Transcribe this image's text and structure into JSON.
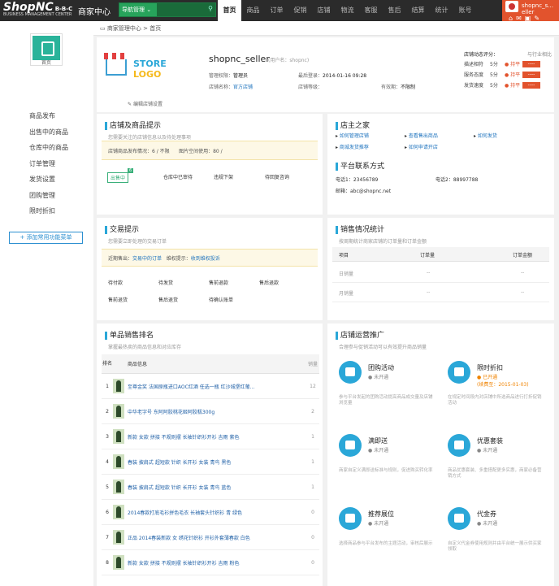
{
  "brand": {
    "logo": "ShopNC",
    "logo_suffix": "B-B-C",
    "sub": "BUSINESS MANAGEMENT CENTER",
    "center_title": "商家中心"
  },
  "search": {
    "select_label": "导航管理 ⌄"
  },
  "nav": [
    "首页",
    "商品",
    "订单",
    "促销",
    "店铺",
    "物流",
    "客服",
    "售后",
    "结算",
    "统计",
    "账号"
  ],
  "user": {
    "name": "shopnc_s...",
    "line2": "eller"
  },
  "breadcrumb": {
    "root": "商家管理中心",
    "sep": ">",
    "current": "首页"
  },
  "sidebar": {
    "icon_label": "首页",
    "items": [
      "商品发布",
      "出售中的商品",
      "仓库中的商品",
      "订单管理",
      "发货设置",
      "团购管理",
      "限时折扣"
    ],
    "add_button": "+ 添加常用功能菜单"
  },
  "shop": {
    "logo_text_a": "STORE ",
    "logo_text_b": "LOGO",
    "edit_label": "编辑店铺设置",
    "name": "shopnc_seller",
    "username": "(用户名：shopnc)",
    "rights_label": "管理权限：",
    "rights_value": "管理员",
    "last_login_label": "最后登录：",
    "last_login_value": "2014-01-16 09:28",
    "grade_label": "店铺名称：",
    "grade_value": "官方店铺",
    "level_label": "店铺等级：",
    "level_value": "",
    "valid_label": "有效期：",
    "valid_value": "不限制"
  },
  "rating": {
    "title": "店铺动态评分：",
    "compare": "与行业相比",
    "rows": [
      {
        "k": "描述相符",
        "v": "5分",
        "c": "● 持平",
        "bar": "----"
      },
      {
        "k": "服务态度",
        "v": "5分",
        "c": "● 持平",
        "bar": "----"
      },
      {
        "k": "发货速度",
        "v": "5分",
        "c": "● 持平",
        "bar": "----"
      }
    ]
  },
  "tips": {
    "title": "店铺及商品提示",
    "sub": "您需要关注的店铺信息以及待处理事项",
    "bar_a": "店铺商品发布情况：6 / 不限",
    "bar_b": "图片空间使用：80 /",
    "links": [
      "出售中",
      "仓库中已审待",
      "违规下架",
      "待回复咨询"
    ],
    "badge": "6"
  },
  "home": {
    "title": "店主之家",
    "links": [
      "如何管理店铺",
      "查看售出商品",
      "如何发货",
      "商城发货推荐",
      "如何申请开店"
    ],
    "contact_title": "平台联系方式",
    "tel1": "电话1：23456789",
    "tel2": "电话2：88997788",
    "email": "邮箱：abc@shopnc.net"
  },
  "trade": {
    "title": "交易提示",
    "sub": "您需要立即处理的交易订单",
    "bar_a": "近期售出：",
    "bar_a_link": "交易中的订单",
    "bar_b": "维权提示：",
    "bar_b_link": "收到维权投诉",
    "items": [
      "待付款",
      "待发货",
      "售前退款",
      "售后退款",
      "售前退货",
      "售后退货",
      "待确认账单"
    ]
  },
  "stats": {
    "title": "销售情况统计",
    "sub": "按周期统计商家店铺的订单量和订单金额",
    "cols": [
      "项目",
      "订单量",
      "订单金额"
    ],
    "rows": [
      {
        "k": "日销量",
        "a": "--",
        "b": "--"
      },
      {
        "k": "月销量",
        "a": "--",
        "b": "--"
      }
    ]
  },
  "ranking": {
    "title": "单品销售排名",
    "sub": "掌握最热卖的商品信息和对应库存",
    "cols": [
      "排名",
      "商品信息",
      "销量"
    ],
    "rows": [
      {
        "n": "1",
        "t": "至尊金奖 法国原瓶进口AOC红酒 任选一瓶 红沙城堡红葡...",
        "q": "12"
      },
      {
        "n": "2",
        "t": "中华老字号 东阿阿胶桃花姬阿胶糕300g",
        "q": "2"
      },
      {
        "n": "3",
        "t": "新款 女款 拼接 不规则摆 长袖针织衫开衫 吉雨 紫色",
        "q": "1"
      },
      {
        "n": "4",
        "t": "春装 披肩式 超短款 针织 长开衫 女装 青鸟 黑色",
        "q": "1"
      },
      {
        "n": "5",
        "t": "春装 披肩式 超短款 针织 长开衫 女装 青鸟 蓝色",
        "q": "1"
      },
      {
        "n": "6",
        "t": "2014春款打底毛衫拼色毛衣 长袖套头针织衫 青 绿色",
        "q": "0"
      },
      {
        "n": "7",
        "t": "正品 2014春装新款 女 绣花针织衫 开衫外套薄春款 白色",
        "q": "0"
      },
      {
        "n": "8",
        "t": "新款 女款 拼接 不规则摆 长袖针织衫开衫 吉雨 粉色",
        "q": "0"
      }
    ]
  },
  "promo": {
    "title": "店铺运营推广",
    "sub": "合理参与促销活动可以有效提升商品销量",
    "items": [
      {
        "name": "团购活动",
        "status": "● 未开通",
        "desc": "参与平台发起的团购活动提高商品成交量及店铺浏览量"
      },
      {
        "name": "限时折扣",
        "status": "● 已开通",
        "extra": "(续费至：2015-01-03)",
        "desc": "在规定时间段内对店铺中所选商品进行打折促销活动"
      },
      {
        "name": "满即送",
        "status": "● 未开通",
        "desc": "商家自定义满即送标准与规则，促进购买转化率"
      },
      {
        "name": "优惠套装",
        "status": "● 未开通",
        "desc": "商品优惠套装、多重搭配更多实惠，商家必备营销方式"
      },
      {
        "name": "推荐展位",
        "status": "● 未开通",
        "desc": "选择商品参与平台发布的主题活动，审核后展示"
      },
      {
        "name": "代金券",
        "status": "● 未开通",
        "desc": "自定义代金券使用规则并由平台统一展示供买家领取"
      }
    ]
  }
}
